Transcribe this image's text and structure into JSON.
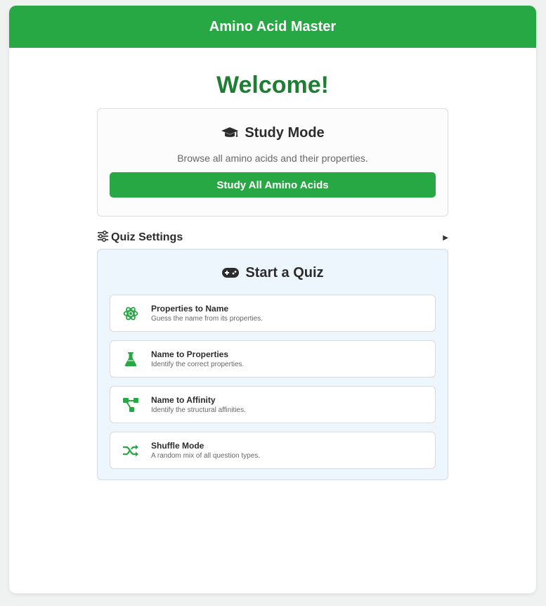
{
  "header": {
    "title": "Amino Acid Master"
  },
  "welcome": {
    "text": "Welcome!"
  },
  "study": {
    "icon": "graduation-cap-icon",
    "title": "Study Mode",
    "description": "Browse all amino acids and their properties.",
    "button_label": "Study All Amino Acids"
  },
  "settings": {
    "icon": "sliders-icon",
    "label": "Quiz Settings",
    "toggle": "▶"
  },
  "quiz": {
    "icon": "gamepad-icon",
    "title": "Start a Quiz",
    "items": [
      {
        "icon": "atom-icon",
        "title": "Properties to Name",
        "description": "Guess the name from its properties."
      },
      {
        "icon": "flask-icon",
        "title": "Name to Properties",
        "description": "Identify the correct properties."
      },
      {
        "icon": "diagram-icon",
        "title": "Name to Affinity",
        "description": "Identify the structural affinities."
      },
      {
        "icon": "shuffle-icon",
        "title": "Shuffle Mode",
        "description": "A random mix of all question types."
      }
    ]
  },
  "colors": {
    "primary": "#28a745",
    "welcome": "#1e7e34",
    "quiz_bg": "#eef6fd"
  }
}
